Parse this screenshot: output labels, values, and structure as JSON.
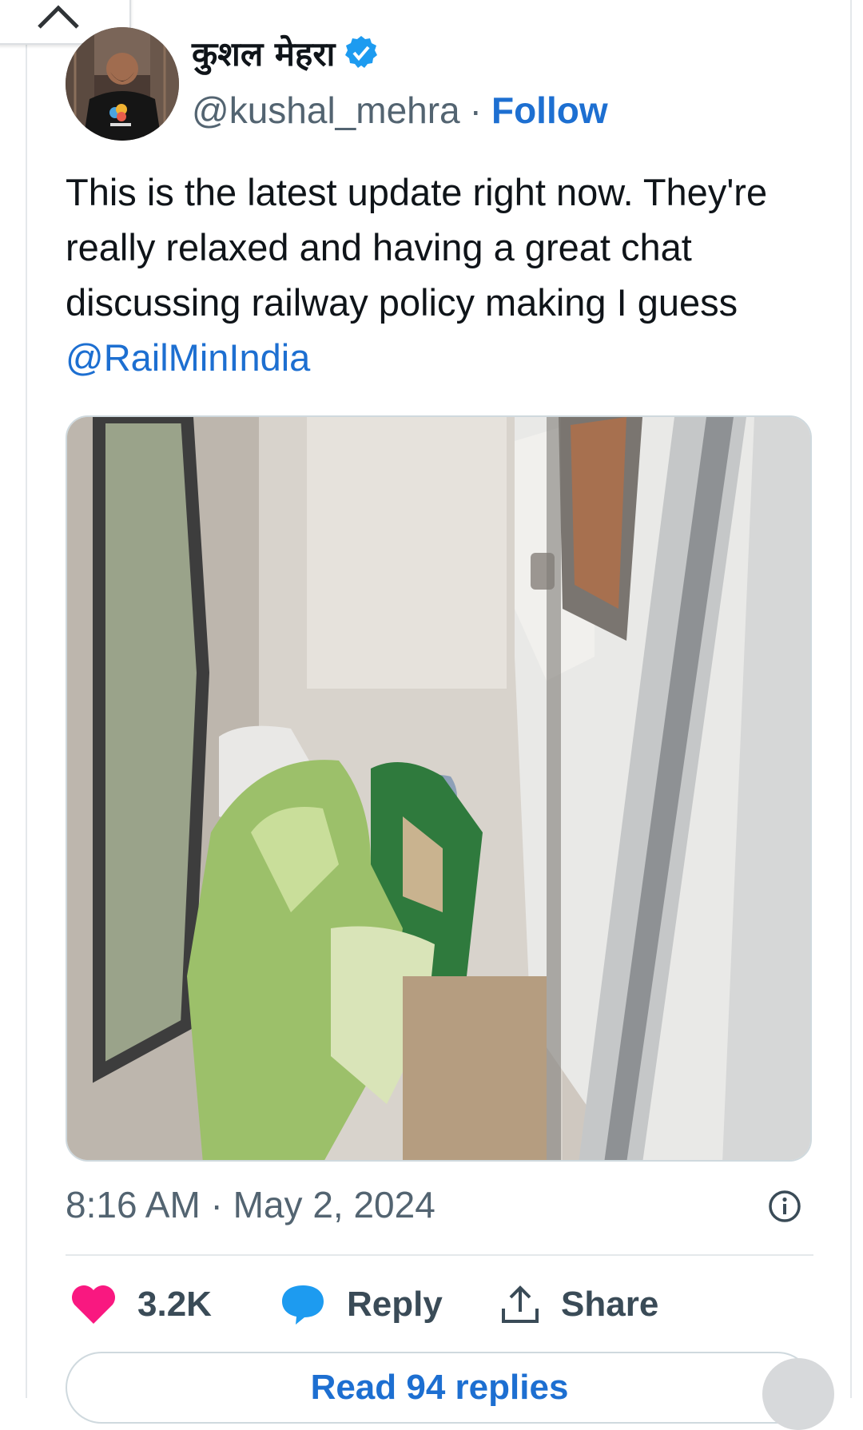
{
  "author": {
    "display_name": "कुशल मेहरा",
    "handle": "@kushal_mehra",
    "separator": "·",
    "follow_label": "Follow"
  },
  "tweet": {
    "text": "This is the latest update right now. They're really relaxed and having a great chat discussing railway policy making I guess ",
    "mention": "@RailMinIndia",
    "timestamp": "8:16 AM · May 2, 2024"
  },
  "actions": {
    "like_count": "3.2K",
    "reply_label": "Reply",
    "share_label": "Share"
  },
  "read_replies_label": "Read 94 replies",
  "colors": {
    "link": "#1d6fd1",
    "like": "#f91880",
    "reply": "#1d9bf0",
    "verified": "#1d9bf0"
  }
}
